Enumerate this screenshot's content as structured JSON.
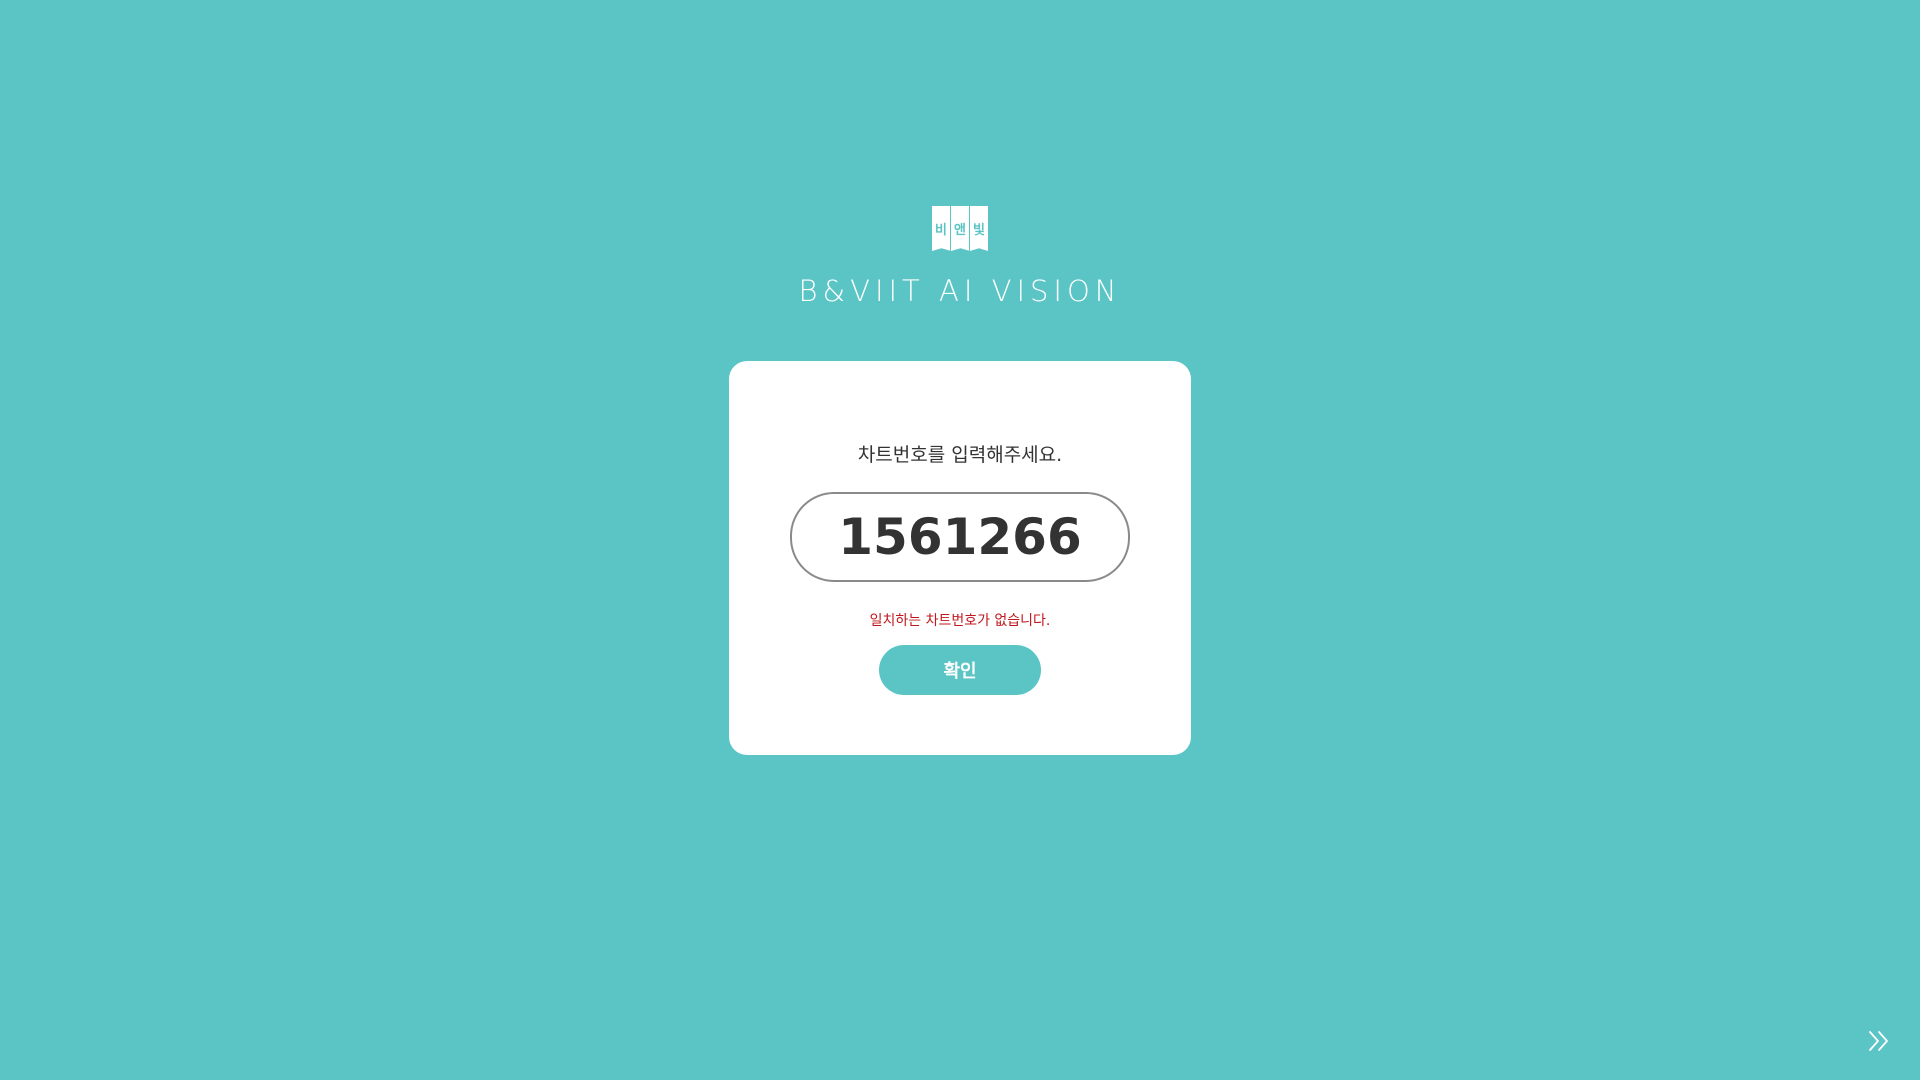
{
  "logo": {
    "panels": [
      "비",
      "앤",
      "빛"
    ],
    "brand_name": "B&VIIT AI VISION"
  },
  "form": {
    "prompt": "차트번호를 입력해주세요.",
    "chart_number_value": "1561266",
    "error_message": "일치하는 차트번호가 없습니다.",
    "confirm_label": "확인"
  },
  "colors": {
    "background": "#5bc5c6",
    "card": "#ffffff",
    "error": "#c0181e",
    "accent": "#5bc5c6"
  },
  "icons": {
    "next": "double-chevron-right-icon"
  }
}
